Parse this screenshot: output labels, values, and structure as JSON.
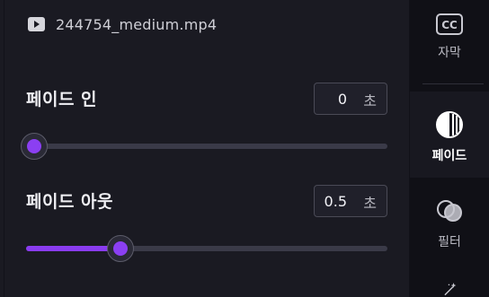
{
  "file": {
    "name": "244754_medium.mp4",
    "icon": "video-file-icon"
  },
  "fade_in": {
    "label": "페이드 인",
    "value": "0",
    "unit": "초",
    "slider_fraction": 0.0
  },
  "fade_out": {
    "label": "페이드 아웃",
    "value": "0.5",
    "unit": "초",
    "slider_fraction": 0.25
  },
  "sidebar": {
    "items": [
      {
        "label": "자막",
        "icon": "captions-icon",
        "active": false
      },
      {
        "label": "페이드",
        "icon": "fade-icon",
        "active": true
      },
      {
        "label": "필터",
        "icon": "filter-icon",
        "active": false
      },
      {
        "label": "",
        "icon": "magic-wand-icon",
        "active": false
      }
    ]
  },
  "colors": {
    "accent": "#8b3ff2",
    "panel_bg": "#1a1a22",
    "sidebar_bg": "#101016"
  }
}
